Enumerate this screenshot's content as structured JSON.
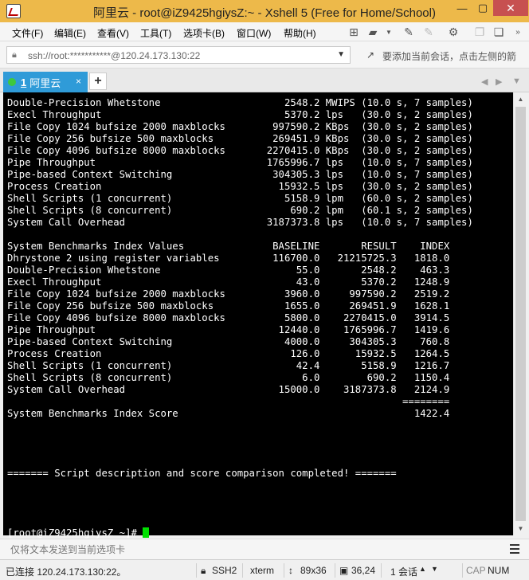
{
  "window": {
    "title": "阿里云 - root@iZ9425hgiysZ:~ - Xshell 5 (Free for Home/School)"
  },
  "menu": [
    "文件(F)",
    "编辑(E)",
    "查看(V)",
    "工具(T)",
    "选项卡(B)",
    "窗口(W)",
    "帮助(H)"
  ],
  "address": {
    "value": "ssh://root:***********@120.24.173.130:22",
    "hint": "要添加当前会话，点击左侧的箭"
  },
  "tab": {
    "number": "1",
    "label": "阿里云",
    "close": "×",
    "add": "+"
  },
  "terminal": {
    "lines": [
      "Double-Precision Whetstone                     2548.2 MWIPS (10.0 s, 7 samples)",
      "Execl Throughput                               5370.2 lps   (30.0 s, 2 samples)",
      "File Copy 1024 bufsize 2000 maxblocks        997590.2 KBps  (30.0 s, 2 samples)",
      "File Copy 256 bufsize 500 maxblocks          269451.9 KBps  (30.0 s, 2 samples)",
      "File Copy 4096 bufsize 8000 maxblocks       2270415.0 KBps  (30.0 s, 2 samples)",
      "Pipe Throughput                             1765996.7 lps   (10.0 s, 7 samples)",
      "Pipe-based Context Switching                 304305.3 lps   (10.0 s, 7 samples)",
      "Process Creation                              15932.5 lps   (30.0 s, 2 samples)",
      "Shell Scripts (1 concurrent)                   5158.9 lpm   (60.0 s, 2 samples)",
      "Shell Scripts (8 concurrent)                    690.2 lpm   (60.1 s, 2 samples)",
      "System Call Overhead                        3187373.8 lps   (10.0 s, 7 samples)",
      "",
      "System Benchmarks Index Values               BASELINE       RESULT    INDEX",
      "Dhrystone 2 using register variables         116700.0   21215725.3   1818.0",
      "Double-Precision Whetstone                       55.0       2548.2    463.3",
      "Execl Throughput                                 43.0       5370.2   1248.9",
      "File Copy 1024 bufsize 2000 maxblocks          3960.0     997590.2   2519.2",
      "File Copy 256 bufsize 500 maxblocks            1655.0     269451.9   1628.1",
      "File Copy 4096 bufsize 8000 maxblocks          5800.0    2270415.0   3914.5",
      "Pipe Throughput                               12440.0    1765996.7   1419.6",
      "Pipe-based Context Switching                   4000.0     304305.3    760.8",
      "Process Creation                                126.0      15932.5   1264.5",
      "Shell Scripts (1 concurrent)                     42.4       5158.9   1216.7",
      "Shell Scripts (8 concurrent)                      6.0        690.2   1150.4",
      "System Call Overhead                          15000.0    3187373.8   2124.9",
      "                                                                   ========",
      "System Benchmarks Index Score                                        1422.4",
      "",
      "",
      "",
      "",
      "======= Script description and score comparison completed! =======",
      "",
      "",
      "",
      ""
    ],
    "prompt": "[root@iZ9425hgiysZ ~]# "
  },
  "sendbar": {
    "placeholder": "仅将文本发送到当前选项卡"
  },
  "status": {
    "connection": "已连接 120.24.173.130:22。",
    "protocol": "SSH2",
    "term": "xterm",
    "size": "89x36",
    "pos": "36,24",
    "sessions": "1 会话",
    "cap": "CAP",
    "num": "NUM"
  },
  "colors": {
    "titlebar": "#edb94a",
    "tab": "#2f9bd8",
    "cursor": "#00e000",
    "close": "#c75050"
  }
}
